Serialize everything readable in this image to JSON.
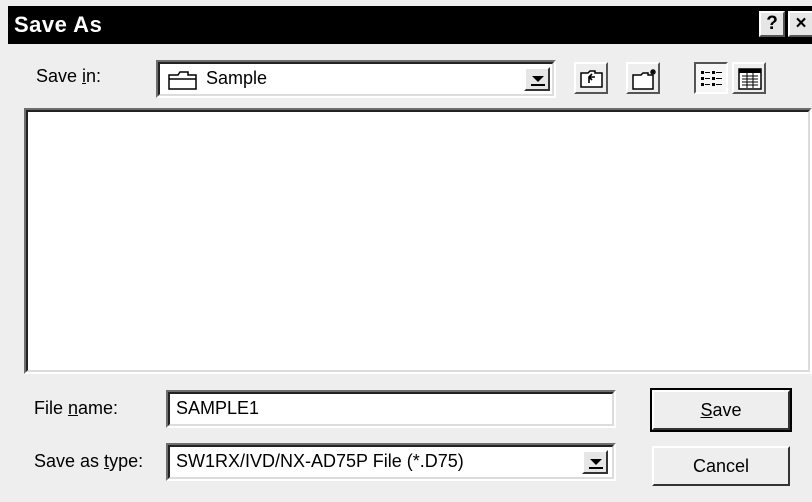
{
  "window": {
    "title": "Save As",
    "help_glyph": "?",
    "close_glyph": "×"
  },
  "toolbar": {
    "save_in_label_pre": "Save ",
    "save_in_label_key": "i",
    "save_in_label_post": "n:",
    "folder_value": "Sample",
    "icons": [
      "folder-icon",
      "up-one-level-icon",
      "create-new-folder-icon",
      "list-view-icon",
      "details-view-icon"
    ]
  },
  "file_list": {
    "items": []
  },
  "form": {
    "filename_label_pre": "File ",
    "filename_label_key": "n",
    "filename_label_post": "ame:",
    "filename_value": "SAMPLE1",
    "type_label_pre": "Save as ",
    "type_label_key": "t",
    "type_label_post": "ype:",
    "type_value": "SW1RX/IVD/NX-AD75P File (*.D75)"
  },
  "buttons": {
    "save_key": "S",
    "save_rest": "ave",
    "cancel_label": "Cancel"
  }
}
